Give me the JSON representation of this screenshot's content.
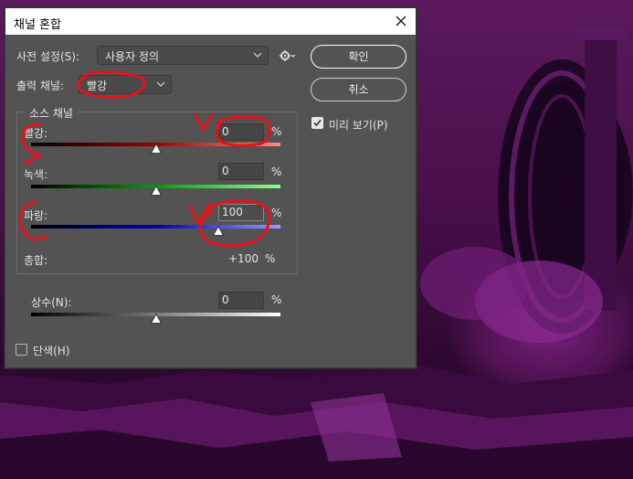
{
  "dialog": {
    "title": "채널 혼합",
    "preset": {
      "label": "사전 설정(S):",
      "value": "사용자 정의"
    },
    "output_channel": {
      "label": "출력 채널:",
      "value": "빨강"
    },
    "source_group": "소스 채널",
    "sliders": [
      {
        "label": "빨강:",
        "value": "0",
        "unit": "%",
        "position": 0.5,
        "track": "red"
      },
      {
        "label": "녹색:",
        "value": "0",
        "unit": "%",
        "position": 0.5,
        "track": "green"
      },
      {
        "label": "파랑:",
        "value": "100",
        "unit": "%",
        "position": 0.75,
        "track": "blue"
      }
    ],
    "total": {
      "label": "총합:",
      "value": "+100",
      "unit": "%"
    },
    "constant": {
      "label": "상수(N):",
      "value": "0",
      "unit": "%",
      "position": 0.5
    },
    "monochrome": {
      "label": "단색(H)",
      "checked": false
    },
    "buttons": {
      "ok": "확인",
      "cancel": "취소"
    },
    "preview": {
      "label": "미리 보기(P)",
      "checked": true
    }
  },
  "colors": {
    "dialog_bg": "#535353",
    "annotation_red": "#e8101a",
    "background_purple": "#5a1a5c"
  }
}
